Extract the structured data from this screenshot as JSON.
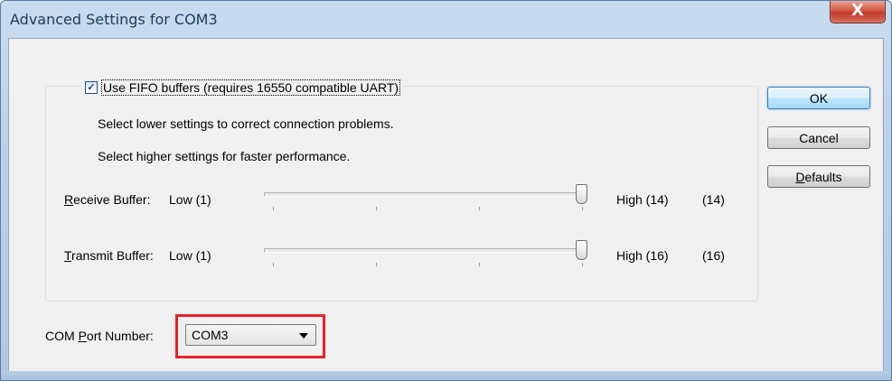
{
  "window": {
    "title": "Advanced Settings for COM3",
    "close_label": "X"
  },
  "fifo": {
    "checked": true,
    "check_glyph": "✓",
    "label": "Use FIFO buffers (requires 16550 compatible UART)",
    "hint_lower": "Select lower settings to correct connection problems.",
    "hint_higher": "Select higher settings for faster performance."
  },
  "receive": {
    "label_mnemonic": "R",
    "label_rest": "eceive Buffer:",
    "low": "Low (1)",
    "high": "High (14)",
    "value": "(14)",
    "level_fraction": 1.0
  },
  "transmit": {
    "label_mnemonic": "T",
    "label_rest": "ransmit Buffer:",
    "low": "Low (1)",
    "high": "High (16)",
    "value": "(16)",
    "level_fraction": 1.0
  },
  "com_port": {
    "label_pre": "COM ",
    "label_mnemonic": "P",
    "label_rest": "ort Number:",
    "selected": "COM3"
  },
  "buttons": {
    "ok": "OK",
    "cancel": "Cancel",
    "defaults_mnemonic": "D",
    "defaults_rest": "efaults"
  },
  "colors": {
    "highlight": "#e8202a",
    "default_button_border": "#3c7fb1"
  }
}
